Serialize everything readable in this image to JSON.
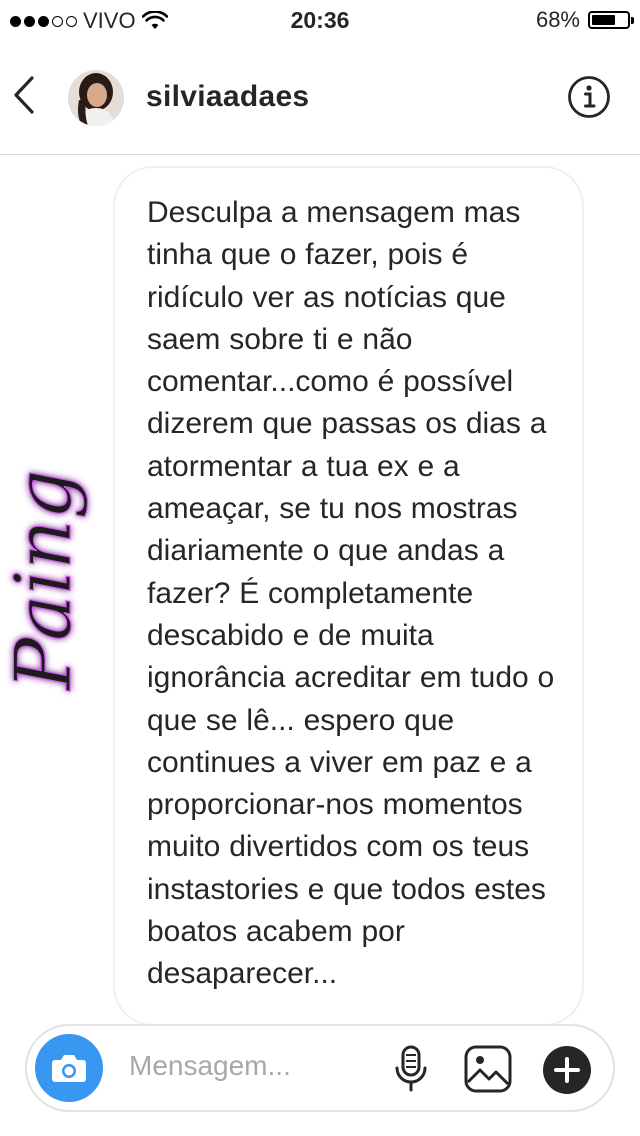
{
  "status_bar": {
    "carrier": "VIVO",
    "time": "20:36",
    "battery": "68%",
    "battery_level": 0.68,
    "signal_bars": 3
  },
  "header": {
    "username": "silviaadaes"
  },
  "message": {
    "text": "Desculpa a mensagem mas tinha que o fazer, pois é ridículo ver as notícias que saem sobre ti e não comentar...como é possível dizerem que passas os dias a atormentar a tua ex e a ameaçar, se tu nos mostras diariamente o que andas a fazer? É completamente descabido e de muita ignorância acreditar em tudo o que se lê... espero que continues a viver em paz e a proporcionar-nos momentos muito divertidos com os teus instastories e que todos estes boatos acabem por desaparecer..."
  },
  "watermark": {
    "text": "Paing",
    "color": "#d05cf0"
  },
  "compose": {
    "placeholder": "Mensagem..."
  },
  "colors": {
    "accent": "#3897f0",
    "text": "#262626",
    "border": "#dbdbdb"
  }
}
